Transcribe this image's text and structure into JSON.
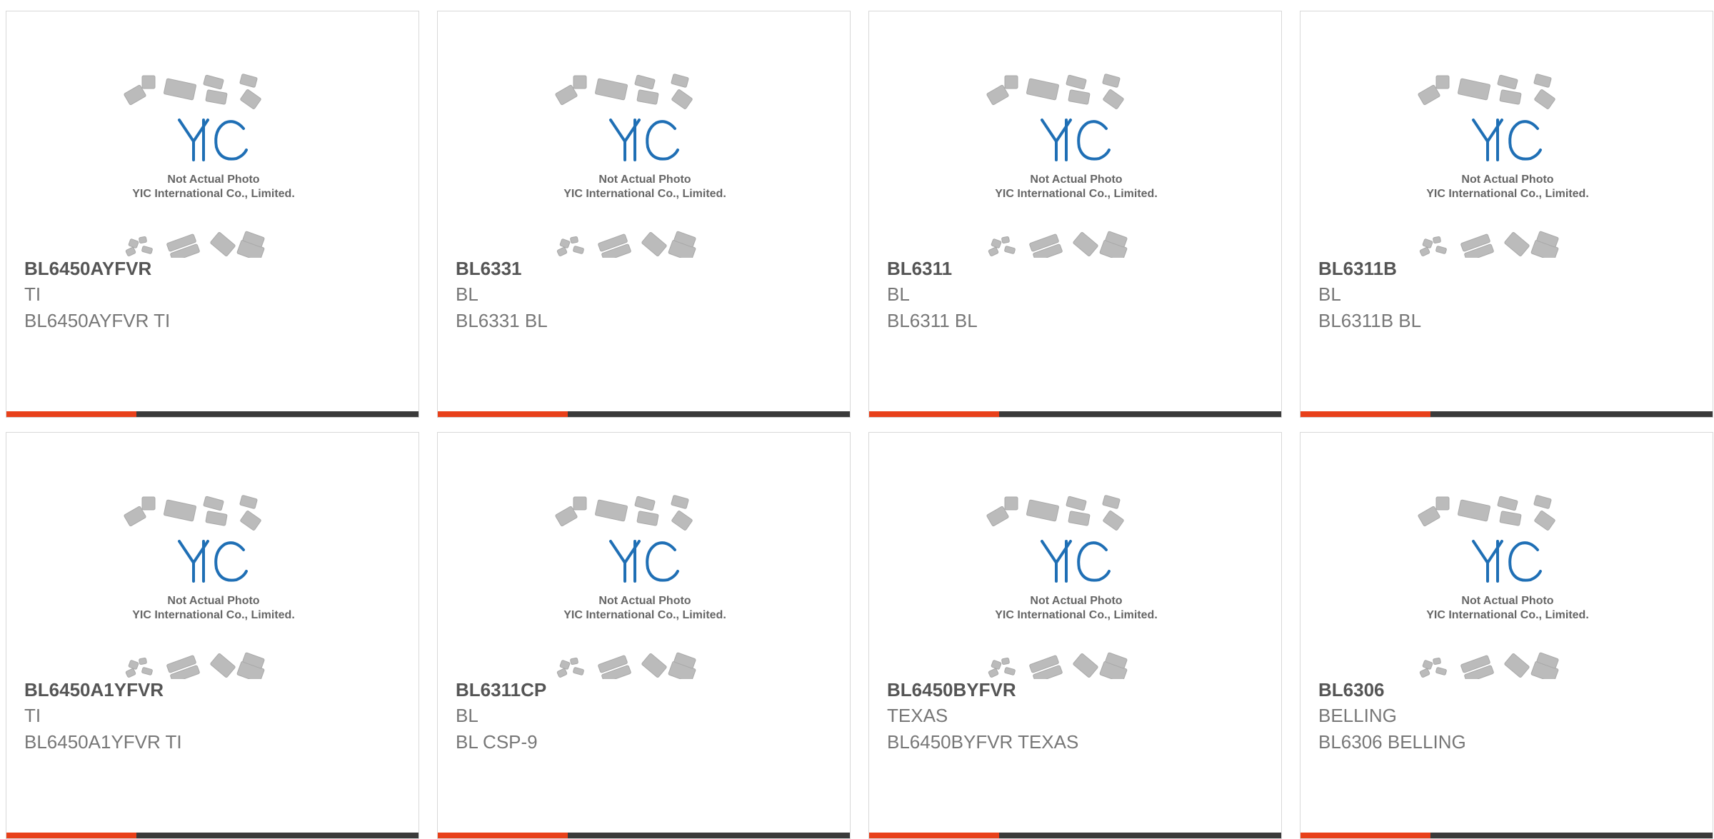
{
  "placeholder_image": {
    "logo_text": "YIC",
    "line1": "Not Actual Photo",
    "line2": "YIC International Co., Limited.",
    "logo_color": "#1f6fb5"
  },
  "colors": {
    "accent": "#e8401a",
    "bar": "#3a3a3a",
    "text_bold": "#555555",
    "text": "#777777",
    "border": "#d8d8d8"
  },
  "products": [
    {
      "part": "BL6450AYFVR",
      "manufacturer": "TI",
      "description": "BL6450AYFVR TI"
    },
    {
      "part": "BL6331",
      "manufacturer": "BL",
      "description": "BL6331 BL"
    },
    {
      "part": "BL6311",
      "manufacturer": "BL",
      "description": "BL6311 BL"
    },
    {
      "part": "BL6311B",
      "manufacturer": "BL",
      "description": "BL6311B BL"
    },
    {
      "part": "BL6450A1YFVR",
      "manufacturer": "TI",
      "description": "BL6450A1YFVR TI"
    },
    {
      "part": "BL6311CP",
      "manufacturer": "BL",
      "description": "BL CSP-9"
    },
    {
      "part": "BL6450BYFVR",
      "manufacturer": "TEXAS",
      "description": "BL6450BYFVR TEXAS"
    },
    {
      "part": "BL6306",
      "manufacturer": "BELLING",
      "description": "BL6306 BELLING"
    }
  ]
}
